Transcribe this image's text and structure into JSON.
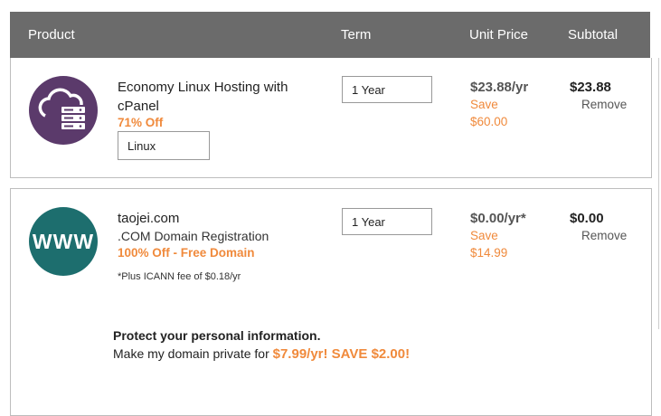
{
  "header": {
    "product": "Product",
    "term": "Term",
    "unit_price": "Unit Price",
    "subtotal": "Subtotal"
  },
  "items": [
    {
      "icon": "cloud-server-icon",
      "icon_color": "#5b3a6b",
      "name": "Economy Linux Hosting with cPanel",
      "discount": "71% Off",
      "os_value": "Linux",
      "term_value": "1 Year",
      "unit_price": "$23.88/yr",
      "save_label": "Save",
      "save_amount": "$60.00",
      "subtotal": "$23.88",
      "remove": "Remove"
    },
    {
      "icon": "www-icon",
      "icon_text": "WWW",
      "icon_color": "#1d6e6e",
      "name": "taojei.com",
      "description": ".COM Domain Registration",
      "discount": "100% Off - Free Domain",
      "note": "*Plus ICANN fee of $0.18/yr",
      "term_value": "1 Year",
      "unit_price": "$0.00/yr*",
      "save_label": "Save",
      "save_amount": "$14.99",
      "subtotal": "$0.00",
      "remove": "Remove",
      "privacy": {
        "title": "Protect your personal information.",
        "text_prefix": "Make my domain private for ",
        "offer": "$7.99/yr! SAVE $2.00!"
      }
    }
  ],
  "colors": {
    "header_bg": "#6b6b6b",
    "accent_orange": "#f08a3c"
  }
}
